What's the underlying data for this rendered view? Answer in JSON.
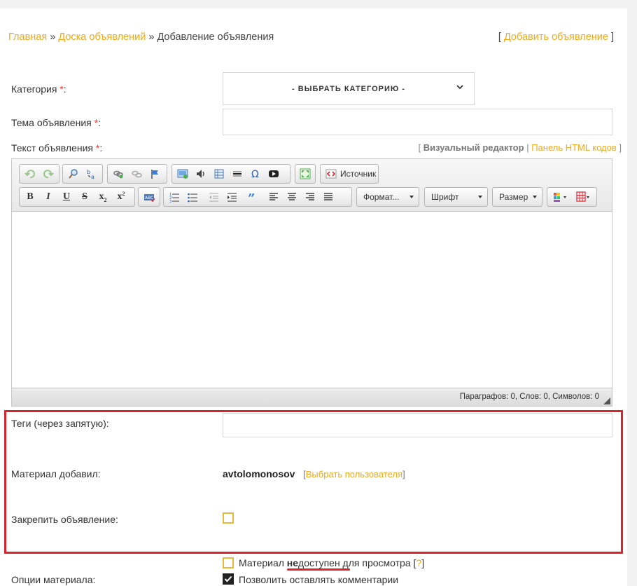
{
  "breadcrumb": {
    "home": "Главная",
    "sep1": "»",
    "board": "Доска объявлений",
    "sep2": "»",
    "current": "Добавление объявления"
  },
  "header": {
    "bracket_open": "[",
    "add_ad": "Добавить объявление",
    "bracket_close": "]"
  },
  "form": {
    "category_label": "Категория",
    "category_select": "- ВЫБРАТЬ КАТЕГОРИЮ -",
    "subject_label": "Тема объявления",
    "text_label": "Текст объявления",
    "required_mark": "*",
    "colon": ":",
    "editor_switch_open": "[",
    "visual_editor": "Визуальный редактор",
    "switch_sep": "|",
    "html_panel": "Панель HTML кодов",
    "editor_switch_close": "]",
    "tags_label": "Теги (через запятую):",
    "added_by_label": "Материал добавил:",
    "added_by_user": "avtolomonosov",
    "pick_user_open": "[",
    "pick_user": "Выбрать пользователя",
    "pick_user_close": "]",
    "pin_label": "Закрепить объявление:",
    "options_label": "Опции материала:",
    "option_unavailable_pre": "Материал ",
    "option_unavailable_bold": "не",
    "option_unavailable_post": "доступен для просмотра [",
    "option_help": "?",
    "option_help_close": "]",
    "option_comments": "Позволить оставлять комментарии"
  },
  "editor": {
    "source_label": "Источник",
    "format_combo": "Формат...",
    "font_combo": "Шрифт",
    "size_combo": "Размер",
    "status": "Параграфов: 0, Слов: 0, Символов: 0",
    "toolbar_icons": [
      "undo-icon",
      "redo-icon",
      "find-icon",
      "replace-icon",
      "link-icon",
      "unlink-icon",
      "anchor-icon",
      "image-icon",
      "audio-icon",
      "table-icon",
      "hr-icon",
      "omega-icon",
      "video-icon",
      "maximize-icon",
      "source-icon",
      "bold-icon",
      "italic-icon",
      "underline-icon",
      "strike-icon",
      "subscript-icon",
      "superscript-icon",
      "spellcheck-icon",
      "ordered-list-icon",
      "bullet-list-icon",
      "outdent-icon",
      "indent-icon",
      "quote-icon",
      "align-left-icon",
      "align-center-icon",
      "align-right-icon",
      "justify-icon",
      "text-color-icon",
      "bg-color-icon"
    ]
  },
  "colors": {
    "link": "#f0a818",
    "required": "#e03a3a",
    "highlight_box": "#d9232d",
    "checkbox_border": "#e8b93c"
  }
}
